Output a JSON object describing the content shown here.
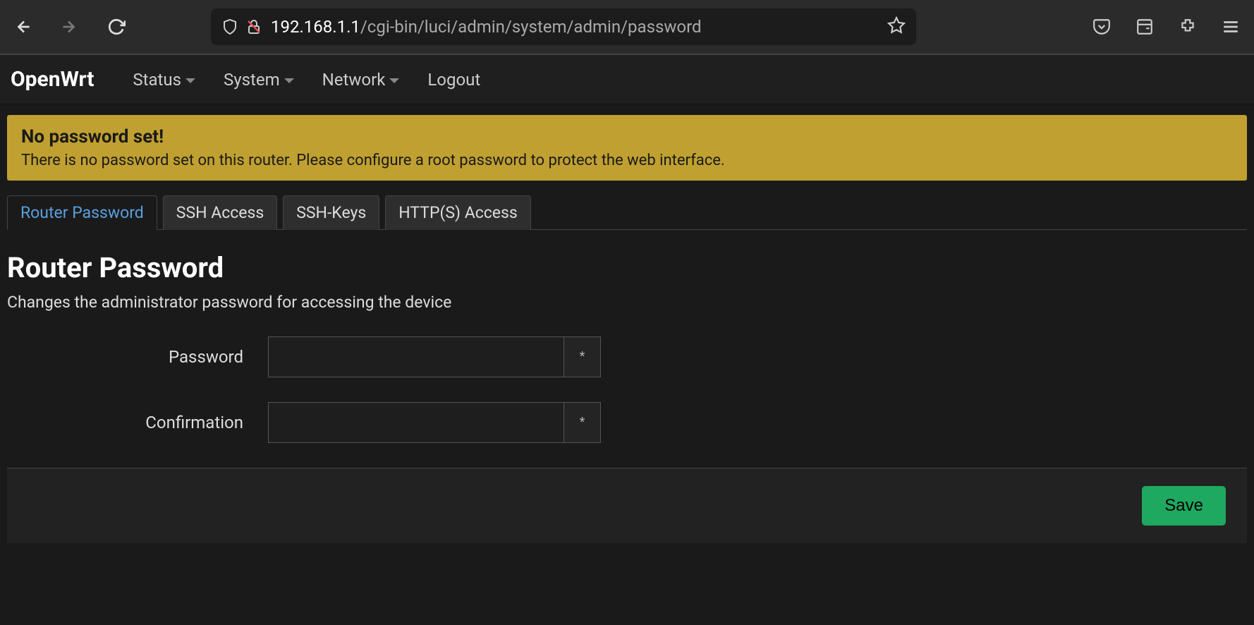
{
  "browser": {
    "url_host": "192.168.1.1",
    "url_path": "/cgi-bin/luci/admin/system/admin/password"
  },
  "brand": "OpenWrt",
  "menu": {
    "status": "Status",
    "system": "System",
    "network": "Network",
    "logout": "Logout"
  },
  "alert": {
    "title": "No password set!",
    "body": "There is no password set on this router. Please configure a root password to protect the web interface."
  },
  "tabs": [
    {
      "label": "Router Password",
      "active": true
    },
    {
      "label": "SSH Access",
      "active": false
    },
    {
      "label": "SSH-Keys",
      "active": false
    },
    {
      "label": "HTTP(S) Access",
      "active": false
    }
  ],
  "page": {
    "title": "Router Password",
    "subtitle": "Changes the administrator password for accessing the device",
    "password_label": "Password",
    "confirm_label": "Confirmation",
    "reveal_glyph": "*",
    "save_label": "Save"
  }
}
